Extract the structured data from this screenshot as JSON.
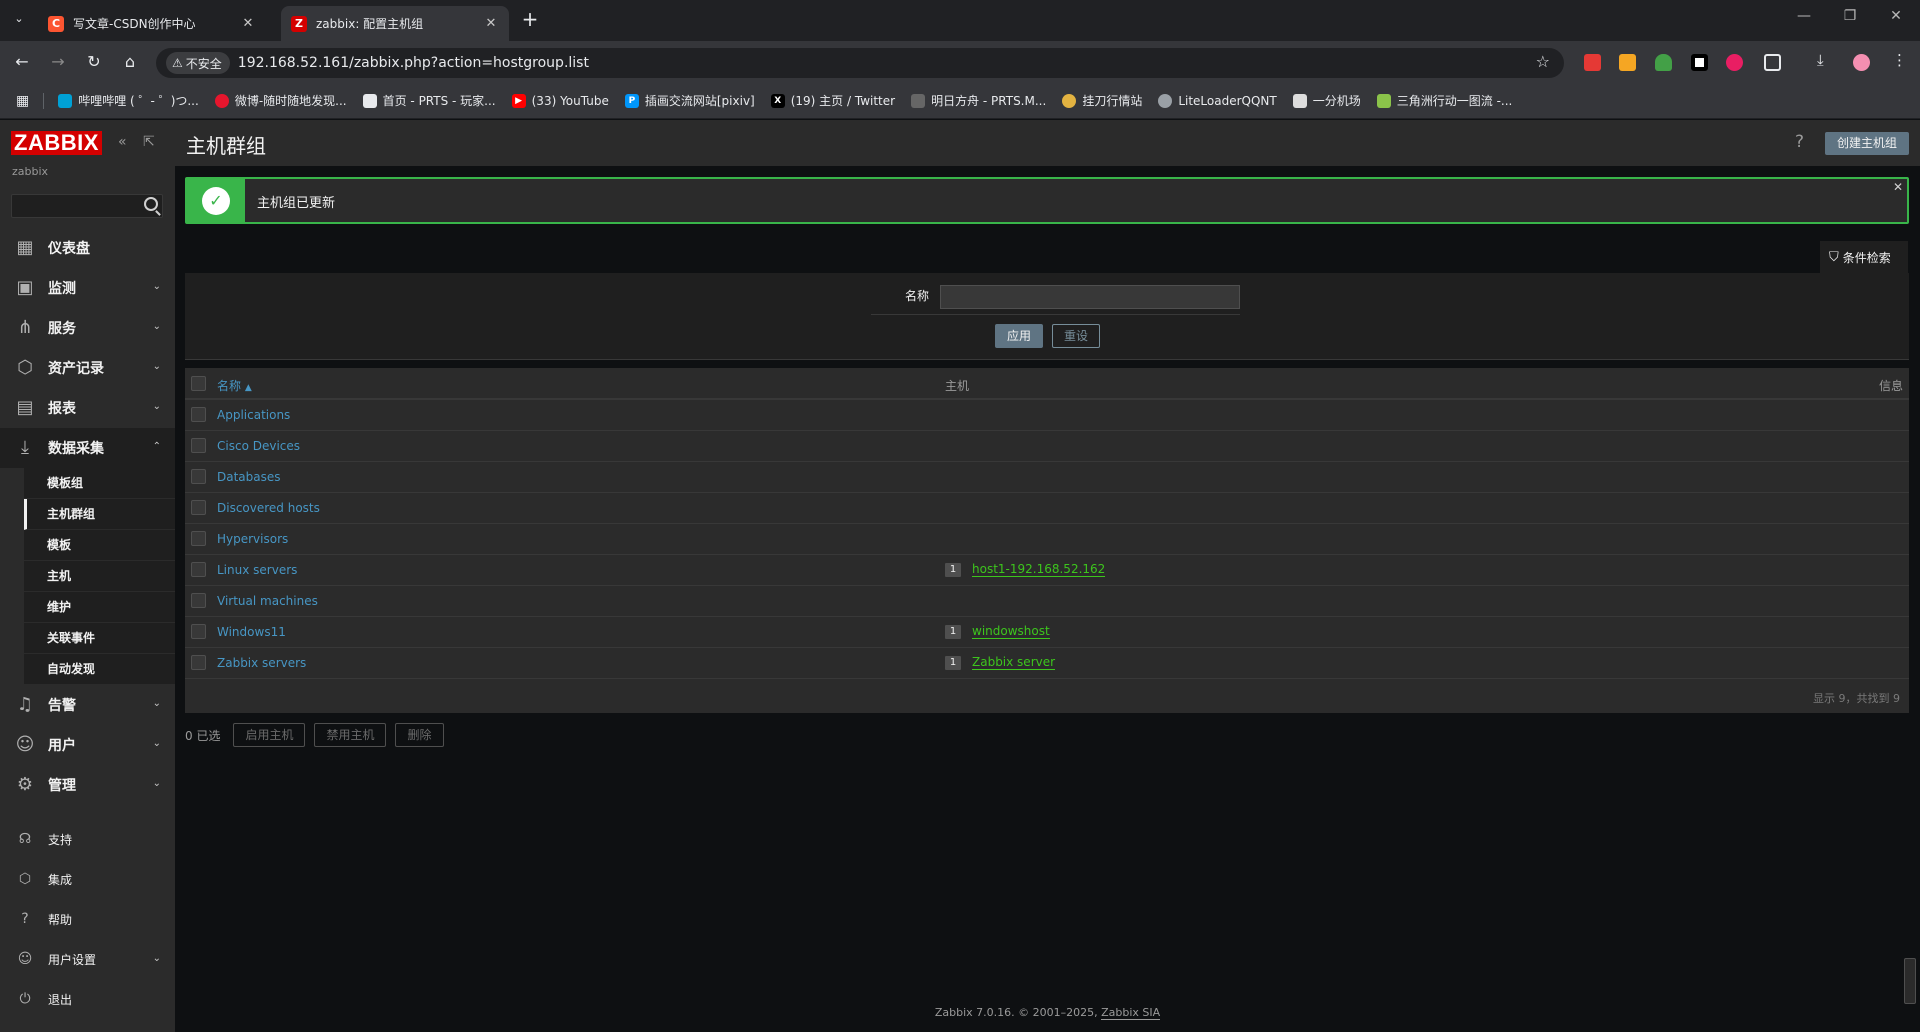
{
  "browser": {
    "tabs": [
      {
        "title": "写文章-CSDN创作中心",
        "favicon": "C",
        "color": "#fc5531",
        "active": false
      },
      {
        "title": "zabbix: 配置主机组",
        "favicon": "Z",
        "color": "#d40000",
        "active": true
      }
    ],
    "address": {
      "security_label": "不安全",
      "url": "192.168.52.161/zabbix.php?action=hostgroup.list"
    },
    "bookmarks": [
      {
        "label": "哔哩哔哩 ( ゜- ゜)つ...",
        "color": "#00a1d6",
        "icon": "tv-icon"
      },
      {
        "label": "微博-随时随地发现...",
        "color": "#e6162d",
        "icon": "weibo-icon"
      },
      {
        "label": "首页 - PRTS - 玩家...",
        "color": "#555555",
        "icon": "prts-icon"
      },
      {
        "label": "(33) YouTube",
        "color": "#ff0000",
        "icon": "youtube-icon"
      },
      {
        "label": "插画交流网站[pixiv]",
        "color": "#0096fa",
        "icon": "pixiv-icon"
      },
      {
        "label": "(19) 主页 / Twitter",
        "color": "#000000",
        "icon": "x-icon"
      },
      {
        "label": "明日方舟 - PRTS.M...",
        "color": "#666666",
        "icon": "arknights-icon"
      },
      {
        "label": "挂刀行情站",
        "color": "#e3b341",
        "icon": "coin-icon"
      },
      {
        "label": "LiteLoaderQQNT",
        "color": "#888888",
        "icon": "globe-icon"
      },
      {
        "label": "一分机场",
        "color": "#dddddd",
        "icon": "plane-icon"
      },
      {
        "label": "三角洲行动一图流 -...",
        "color": "#8bc34a",
        "icon": "delta-icon"
      }
    ]
  },
  "sidebar": {
    "logo": "ZABBIX",
    "server_name": "zabbix",
    "search_placeholder": "",
    "menu": [
      {
        "label": "仪表盘",
        "icon": "dashboard-icon",
        "has_chevron": false
      },
      {
        "label": "监测",
        "icon": "monitoring-icon",
        "has_chevron": true
      },
      {
        "label": "服务",
        "icon": "services-icon",
        "has_chevron": true
      },
      {
        "label": "资产记录",
        "icon": "inventory-icon",
        "has_chevron": true
      },
      {
        "label": "报表",
        "icon": "reports-icon",
        "has_chevron": true
      },
      {
        "label": "数据采集",
        "icon": "data-collection-icon",
        "has_chevron": true
      }
    ],
    "submenu": [
      {
        "label": "模板组"
      },
      {
        "label": "主机群组"
      },
      {
        "label": "模板"
      },
      {
        "label": "主机"
      },
      {
        "label": "维护"
      },
      {
        "label": "关联事件"
      },
      {
        "label": "自动发现"
      }
    ],
    "menu_lower": [
      {
        "label": "告警",
        "icon": "bell-icon"
      },
      {
        "label": "用户",
        "icon": "users-icon"
      },
      {
        "label": "管理",
        "icon": "gear-icon"
      }
    ],
    "bottom": [
      {
        "label": "支持",
        "icon": "headset-icon",
        "has_chevron": false
      },
      {
        "label": "集成",
        "icon": "integrations-icon",
        "has_chevron": false
      },
      {
        "label": "帮助",
        "icon": "help-icon",
        "has_chevron": false
      },
      {
        "label": "用户设置",
        "icon": "user-settings-icon",
        "has_chevron": true
      },
      {
        "label": "退出",
        "icon": "power-icon",
        "has_chevron": false
      }
    ]
  },
  "header": {
    "title": "主机群组",
    "help": "?",
    "create_button": "创建主机组"
  },
  "message": {
    "text": "主机组已更新",
    "status_color": "#39b54a"
  },
  "filter": {
    "tab_label": "条件检索",
    "name_label": "名称",
    "name_value": "",
    "apply": "应用",
    "reset": "重设"
  },
  "table": {
    "columns": {
      "name": "名称",
      "sort_indicator": "▲",
      "hosts": "主机",
      "info": "信息"
    },
    "rows": [
      {
        "name": "Applications",
        "count": "",
        "host": ""
      },
      {
        "name": "Cisco Devices",
        "count": "",
        "host": ""
      },
      {
        "name": "Databases",
        "count": "",
        "host": ""
      },
      {
        "name": "Discovered hosts",
        "count": "",
        "host": ""
      },
      {
        "name": "Hypervisors",
        "count": "",
        "host": ""
      },
      {
        "name": "Linux servers",
        "count": "1",
        "host": "host1-192.168.52.162"
      },
      {
        "name": "Virtual machines",
        "count": "",
        "host": ""
      },
      {
        "name": "Windows11",
        "count": "1",
        "host": "windowshost"
      },
      {
        "name": "Zabbix servers",
        "count": "1",
        "host": "Zabbix server"
      }
    ],
    "footer": "显示 9，共找到 9"
  },
  "actions": {
    "selected": "0 已选",
    "enable": "启用主机",
    "disable": "禁用主机",
    "delete": "删除"
  },
  "footer": {
    "text": "Zabbix 7.0.16. © 2001–2025,",
    "company": "Zabbix SIA"
  }
}
